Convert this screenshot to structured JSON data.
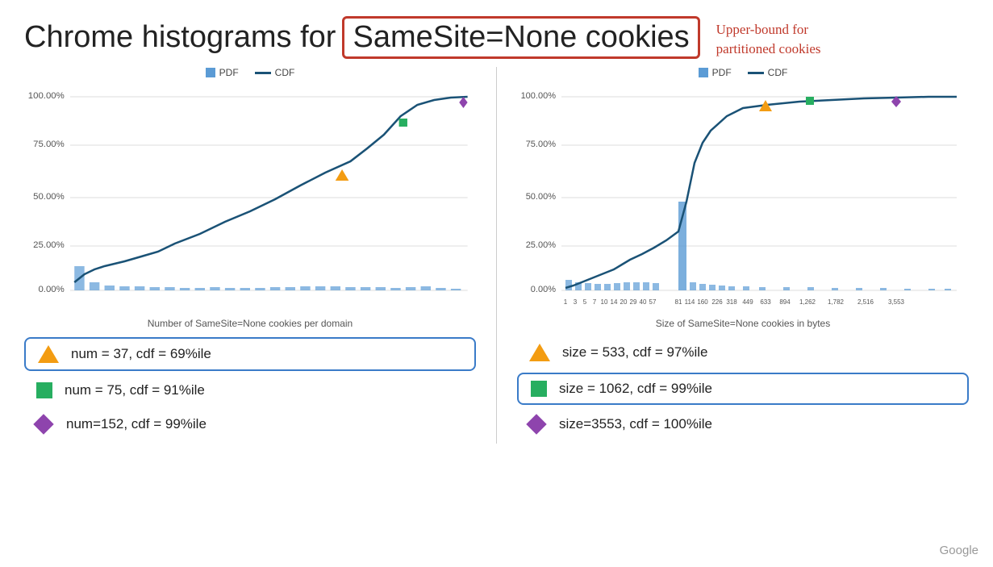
{
  "title": {
    "prefix": "Chrome histograms for",
    "highlight": "SameSite=None cookies",
    "annotation_line1": "Upper-bound for",
    "annotation_line2": "partitioned cookies"
  },
  "left_chart": {
    "legend": {
      "pdf_label": "PDF",
      "cdf_label": "CDF"
    },
    "x_label": "Number of SameSite=None cookies per domain",
    "y_labels": [
      "0.00%",
      "25.00%",
      "50.00%",
      "75.00%",
      "100.00%"
    ],
    "info_boxes": [
      {
        "icon": "triangle",
        "text": "num = 37, cdf = 69%ile",
        "highlighted": true
      },
      {
        "icon": "square",
        "text": "num = 75, cdf = 91%ile",
        "highlighted": false
      },
      {
        "icon": "diamond",
        "text": "num=152, cdf = 99%ile",
        "highlighted": false
      }
    ]
  },
  "right_chart": {
    "legend": {
      "pdf_label": "PDF",
      "cdf_label": "CDF"
    },
    "x_label": "Size of SameSite=None cookies in bytes",
    "x_ticks": [
      "1",
      "3",
      "5",
      "7",
      "10",
      "14",
      "20",
      "29",
      "40",
      "57",
      "81",
      "114",
      "160",
      "226",
      "318",
      "449",
      "633",
      "894",
      "1,262",
      "1,782",
      "2,516",
      "3,553"
    ],
    "y_labels": [
      "0.00%",
      "25.00%",
      "50.00%",
      "75.00%",
      "100.00%"
    ],
    "info_boxes": [
      {
        "icon": "triangle",
        "text": "size = 533, cdf = 97%ile",
        "highlighted": false
      },
      {
        "icon": "square",
        "text": "size = 1062, cdf = 99%ile",
        "highlighted": true
      },
      {
        "icon": "diamond",
        "text": "size=3553, cdf = 100%ile",
        "highlighted": false
      }
    ]
  },
  "google_label": "Google"
}
